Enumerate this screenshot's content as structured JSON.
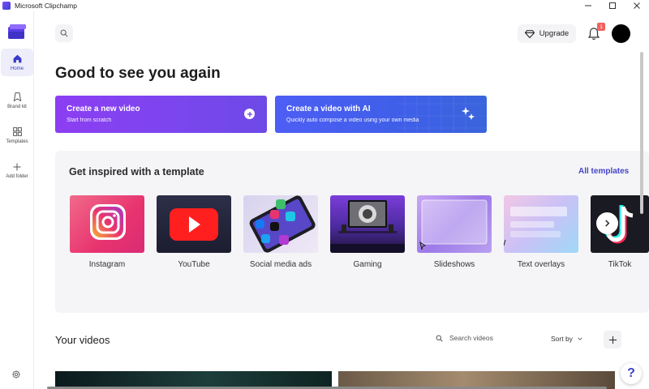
{
  "window": {
    "title": "Microsoft Clipchamp",
    "controls": [
      "minimize",
      "maximize",
      "close"
    ]
  },
  "sidebar": {
    "items": [
      {
        "label": "Home",
        "icon": "home-icon",
        "active": true
      },
      {
        "label": "Brand kit",
        "icon": "brand-kit-icon",
        "active": false
      },
      {
        "label": "Templates",
        "icon": "templates-icon",
        "active": false
      },
      {
        "label": "Add folder",
        "icon": "plus-icon",
        "active": false
      }
    ],
    "settings_icon": "gear-icon"
  },
  "header": {
    "upgrade_label": "Upgrade",
    "notification_count": "1"
  },
  "greeting": "Good to see you again",
  "create_cards": [
    {
      "title": "Create a new video",
      "subtitle": "Start from scratch"
    },
    {
      "title": "Create a video with AI",
      "subtitle": "Quickly auto compose a video using your own media"
    }
  ],
  "templates": {
    "heading": "Get inspired with a template",
    "all_link": "All templates",
    "items": [
      {
        "label": "Instagram"
      },
      {
        "label": "YouTube"
      },
      {
        "label": "Social media ads"
      },
      {
        "label": "Gaming"
      },
      {
        "label": "Slideshows"
      },
      {
        "label": "Text overlays"
      },
      {
        "label": "TikTok"
      }
    ]
  },
  "videos": {
    "heading": "Your videos",
    "search_placeholder": "Search videos",
    "sort_label": "Sort by"
  },
  "help_label": "?",
  "colors": {
    "accent": "#4444c8",
    "create_card_1": "#8c3ef2",
    "create_card_2": "#4d5ef5",
    "badge": "#f0625e",
    "panel_bg": "#f5f5f8"
  }
}
